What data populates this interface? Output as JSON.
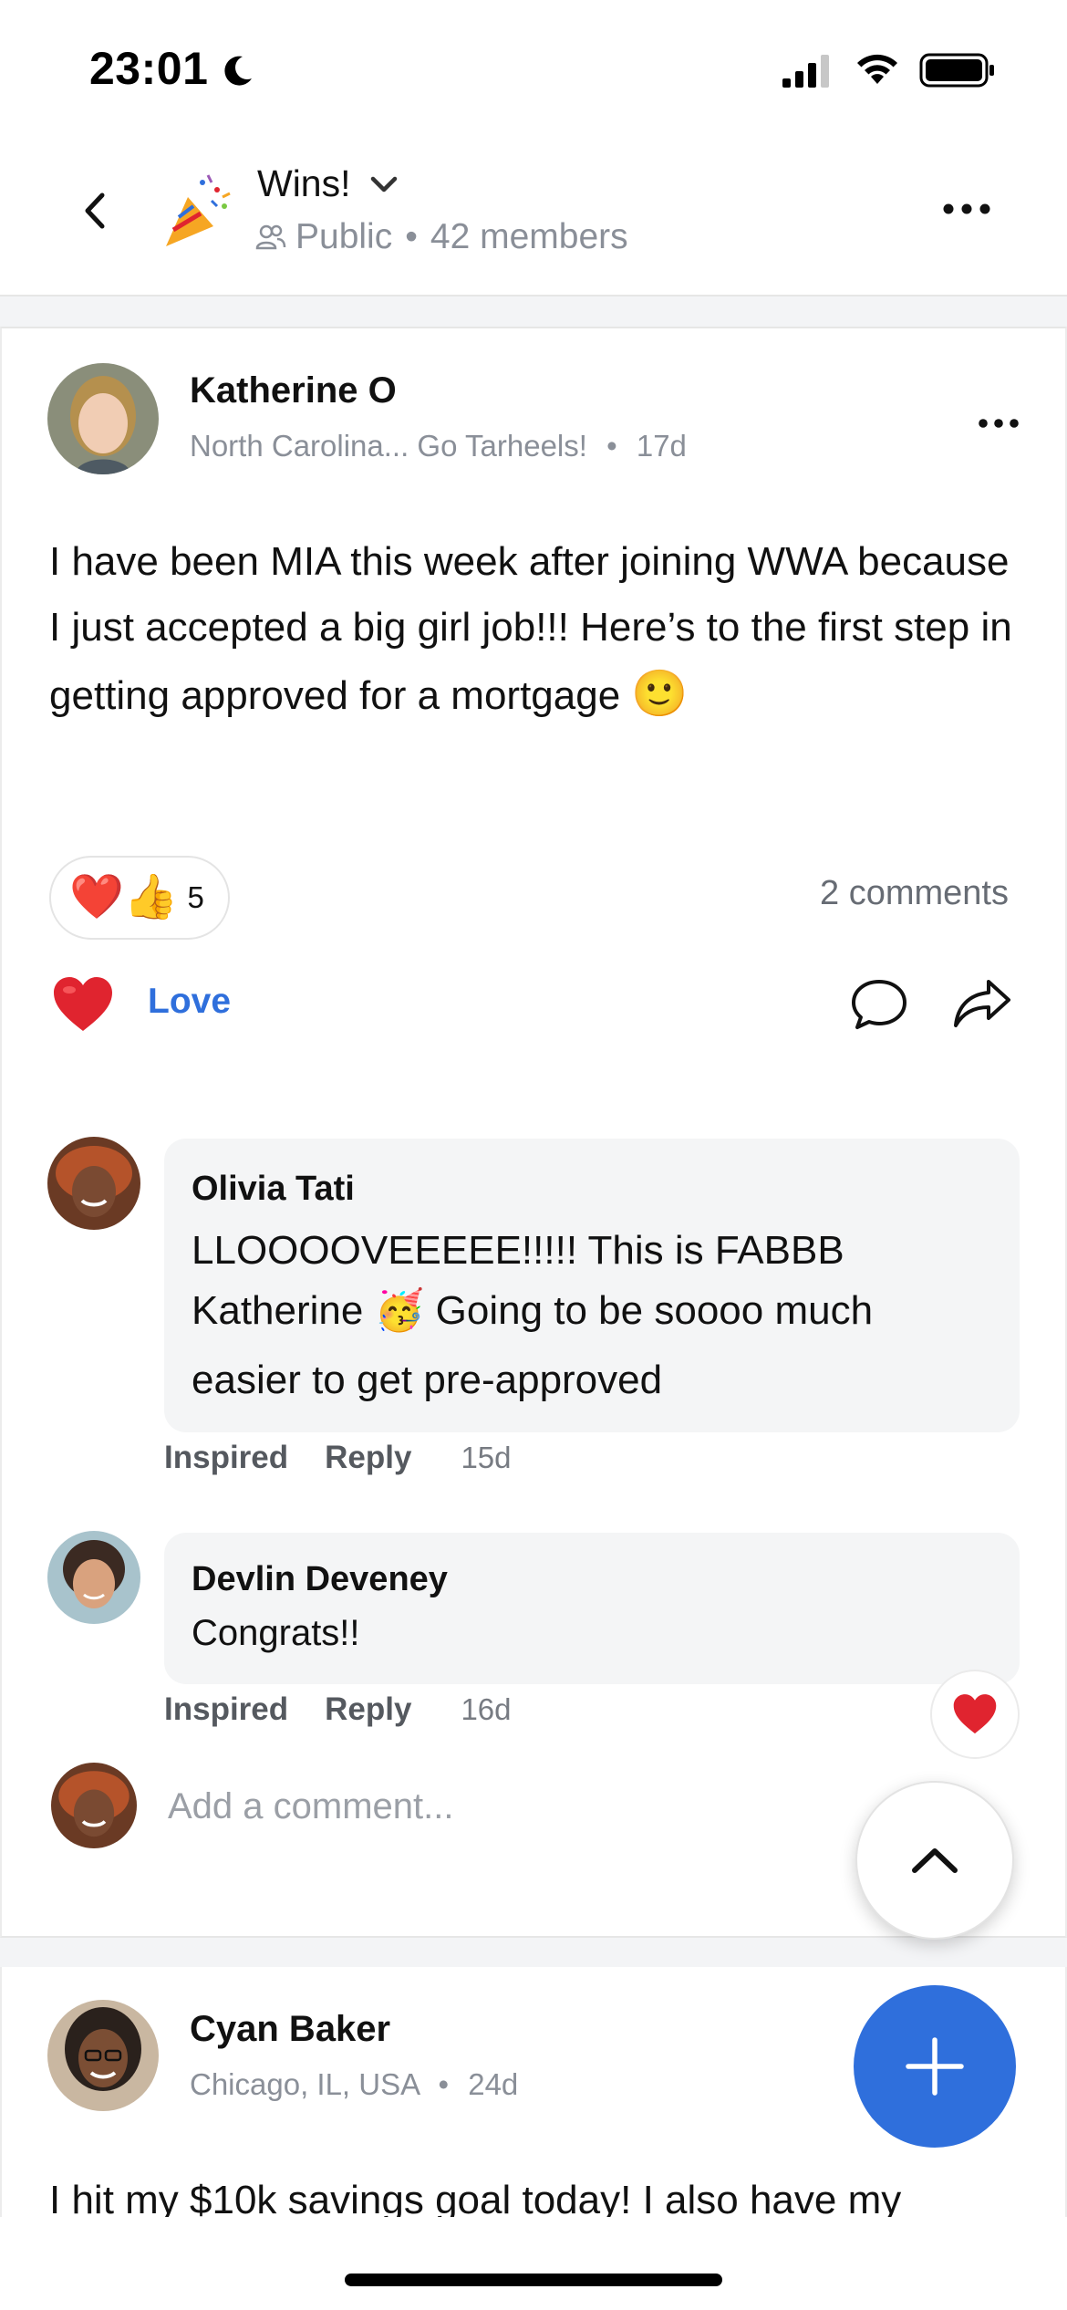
{
  "status_bar": {
    "time": "23:01"
  },
  "group": {
    "name": "Wins!",
    "visibility": "Public",
    "members": "42 members"
  },
  "post": {
    "author": "Katherine O",
    "location": "North Carolina... Go Tarheels!",
    "age": "17d",
    "body": "I have been MIA this week after joining WWA because I just accepted a big girl job!!! Here’s to the first step in getting approved for a mortgage",
    "body_emoji": "🙂",
    "reactions": {
      "emojis": [
        "❤️",
        "👍"
      ],
      "count": "5"
    },
    "comments_count": "2 comments",
    "love_label": "Love",
    "comments": [
      {
        "author": "Olivia Tati",
        "text_line1": "LLOOOOVEEEEE!!!!! This is FABBB",
        "text_line2_a": "Katherine",
        "text_emoji": "🥳",
        "text_line2_b": "Going to be soooo much",
        "text_line3": "easier to get pre-approved",
        "action_inspired": "Inspired",
        "action_reply": "Reply",
        "age": "15d"
      },
      {
        "author": "Devlin Deveney",
        "text": "Congrats!!",
        "action_inspired": "Inspired",
        "action_reply": "Reply",
        "age": "16d"
      }
    ],
    "add_comment_placeholder": "Add a comment..."
  },
  "post2": {
    "author": "Cyan Baker",
    "location": "Chicago, IL, USA",
    "age": "24d",
    "body_preview": "I hit my $10k savings goal today! I also have my"
  },
  "colors": {
    "accent": "#2f6fdc",
    "heart": "#e0242f",
    "muted_text": "#8a8f98",
    "comment_bg": "#f4f5f6"
  },
  "icons": [
    "moon-icon",
    "signal-icon",
    "wifi-icon",
    "battery-icon",
    "back-icon",
    "party-popper-icon",
    "chevron-down-icon",
    "people-icon",
    "more-icon",
    "heart-icon",
    "comment-icon",
    "share-icon",
    "chevron-up-icon",
    "plus-icon"
  ]
}
